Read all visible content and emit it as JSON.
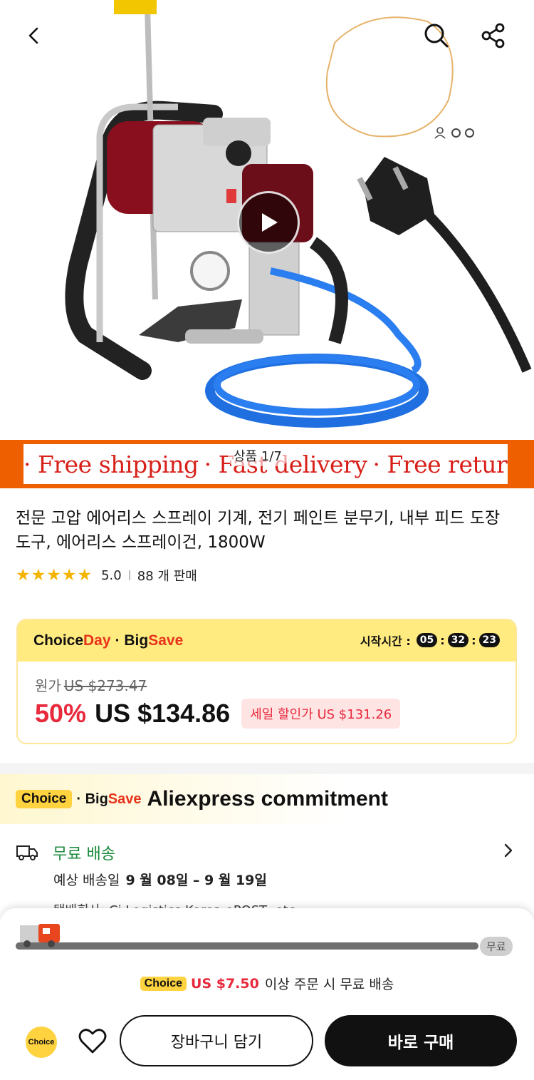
{
  "header": {
    "back_icon": "chevron-left-icon",
    "search_icon": "search-icon",
    "share_icon": "share-icon"
  },
  "gallery": {
    "counter": "상품 1/7",
    "play_icon": "play-icon"
  },
  "banner": {
    "items": [
      "· Free shipping",
      "· Fast delivery",
      "· Free returns"
    ],
    "bg_color": "#ee5f00",
    "text_color": "#d8201a"
  },
  "product": {
    "title": "전문 고압 에어리스 스프레이 기계, 전기 페인트 분무기, 내부 피드 도장 도구, 에어리스 스프레이건, 1800W",
    "stars": "★★★★★",
    "rating": "5.0",
    "sold": "88 개 판매"
  },
  "price_card": {
    "choice_word": "Choice",
    "day_word": "Day",
    "bigsave_prefix": "· Big",
    "bigsave_suffix": "Save",
    "timer_label": "시작시간 :",
    "timer": {
      "h": "05",
      "m": "32",
      "s": "23"
    },
    "original_label": "원가",
    "original_price": "US $273.47",
    "discount": "50%",
    "price": "US $134.86",
    "sale_tag": "세일 할인가 US $131.26"
  },
  "commitment": {
    "choice_badge": "Choice",
    "bigsave_prefix": "· Big",
    "bigsave_suffix": "Save",
    "title": "Aliexpress commitment",
    "free_shipping": "무료 배송",
    "eta_label": "예상 배송일",
    "eta_range": "9 월 08일 – 9 월 19일",
    "carrier": "택배회사:  Cj Logistics  Korea ePOST, etc"
  },
  "sheet": {
    "progress_pct": 100,
    "free_pill": "무료",
    "threshold_badge": "Choice",
    "threshold_amount": "US $7.50",
    "threshold_text": "이상 주문 시 무료 배송",
    "choice_icon_label": "Choice",
    "cart_button": "장바구니 담기",
    "buy_button": "바로 구매"
  }
}
